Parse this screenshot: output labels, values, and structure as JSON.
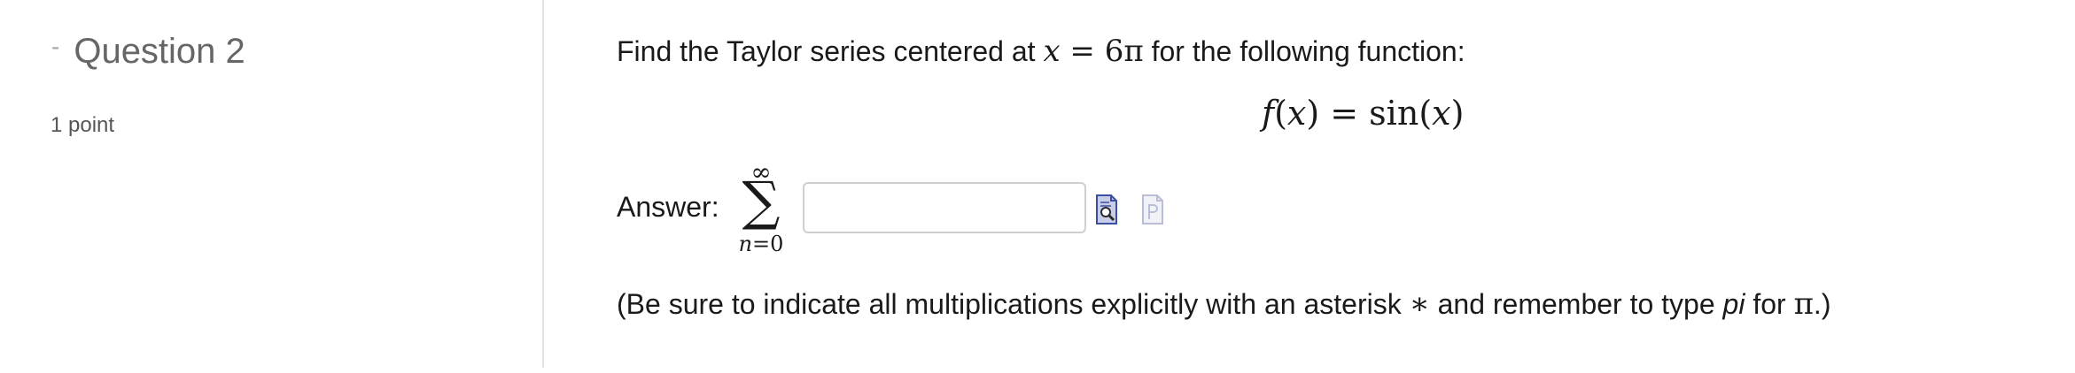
{
  "question": {
    "collapse_symbol": "-",
    "title": "Question 2",
    "points": "1 point"
  },
  "problem": {
    "prompt_before": "Find the Taylor series centered at ",
    "center_var": "x",
    "center_eq": " = 6π",
    "prompt_after": " for the following function:",
    "function": {
      "name": "f",
      "arg": "x",
      "rhs": "sin",
      "rhs_arg": "x"
    }
  },
  "answer": {
    "label": "Answer:",
    "sum_upper": "∞",
    "sum_symbol": "∑",
    "sum_index": "n",
    "sum_lower_eq": "=0",
    "input_value": "",
    "input_placeholder": "",
    "preview_icon": "equation-preview-icon",
    "entry_icon": "equation-entry-icon"
  },
  "note": {
    "part1": "(Be sure to indicate all multiplications explicitly with an asterisk ",
    "asterisk": "∗",
    "part2": " and remember to type ",
    "pi_word": "pi",
    "part3": " for ",
    "pi_symbol": "π",
    "part4": ".)"
  },
  "colors": {
    "divider": "#e4e4e4",
    "title": "#666666",
    "input_border": "#cfcfcf",
    "icon_blue": "#3d4fa0"
  }
}
